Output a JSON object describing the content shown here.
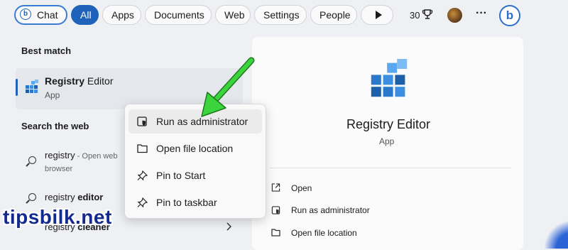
{
  "filters": {
    "chat": "Chat",
    "all": "All",
    "apps": "Apps",
    "documents": "Documents",
    "web": "Web",
    "settings": "Settings",
    "people": "People",
    "points": "30",
    "more": "···"
  },
  "left": {
    "best_match_heading": "Best match",
    "best_match": {
      "name_bold": "Registry",
      "name_rest": " Editor",
      "type": "App"
    },
    "search_web_heading": "Search the web",
    "web_results": [
      {
        "main": "registry",
        "sub": " - Open web",
        "sub2": "browser"
      },
      {
        "main": "registry ",
        "bold": "editor"
      },
      {
        "main": "registry ",
        "bold": "cleaner"
      }
    ]
  },
  "detail": {
    "title": "Registry Editor",
    "subtitle": "App",
    "actions": [
      "Open",
      "Run as administrator",
      "Open file location"
    ]
  },
  "context_menu": {
    "items": [
      "Run as administrator",
      "Open file location",
      "Pin to Start",
      "Pin to taskbar"
    ]
  },
  "watermark": "tipsbilk.net",
  "colors": {
    "accent": "#1f62b9",
    "arrow": "#3cd43c",
    "watermark": "#142a8f"
  }
}
